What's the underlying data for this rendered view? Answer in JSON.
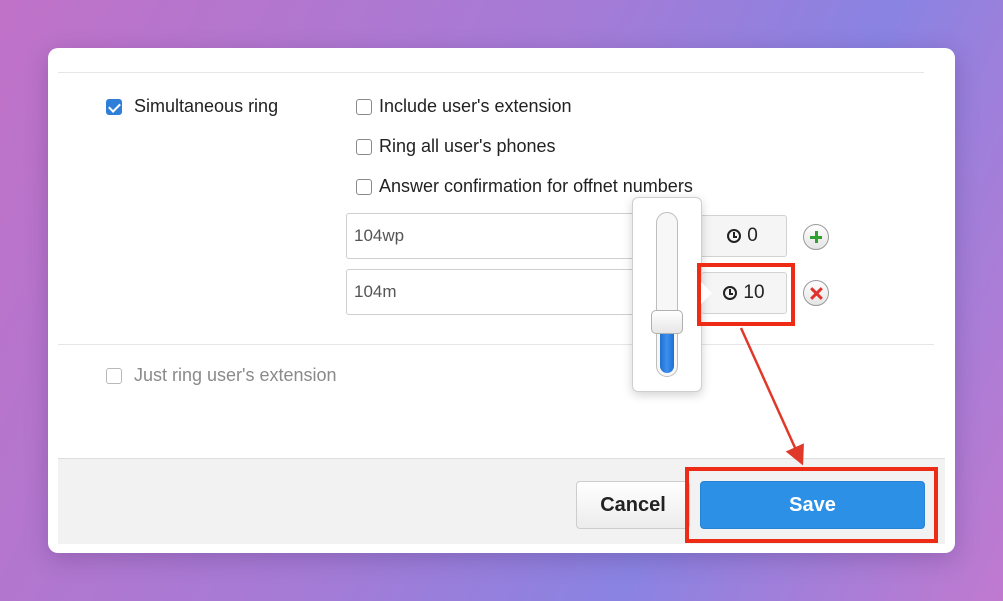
{
  "simultaneous_ring": {
    "label": "Simultaneous ring",
    "checked": true
  },
  "options": [
    {
      "label": "Include user's extension",
      "checked": false
    },
    {
      "label": "Ring all user's phones",
      "checked": false
    },
    {
      "label": "Answer confirmation for offnet numbers",
      "checked": false
    }
  ],
  "numbers": [
    {
      "value": "104wp",
      "delay": "0",
      "action_icon": "add-icon"
    },
    {
      "value": "104m",
      "delay": "10",
      "action_icon": "remove-icon"
    }
  ],
  "just_ring": {
    "label": "Just ring user's extension",
    "checked": false
  },
  "delay_slider": {
    "level": 0.33
  },
  "footer": {
    "cancel_label": "Cancel",
    "save_label": "Save"
  },
  "colors": {
    "accent": "#2b90e6",
    "highlight": "#ee2b14",
    "add": "#2fa12f",
    "remove": "#e0312a"
  }
}
